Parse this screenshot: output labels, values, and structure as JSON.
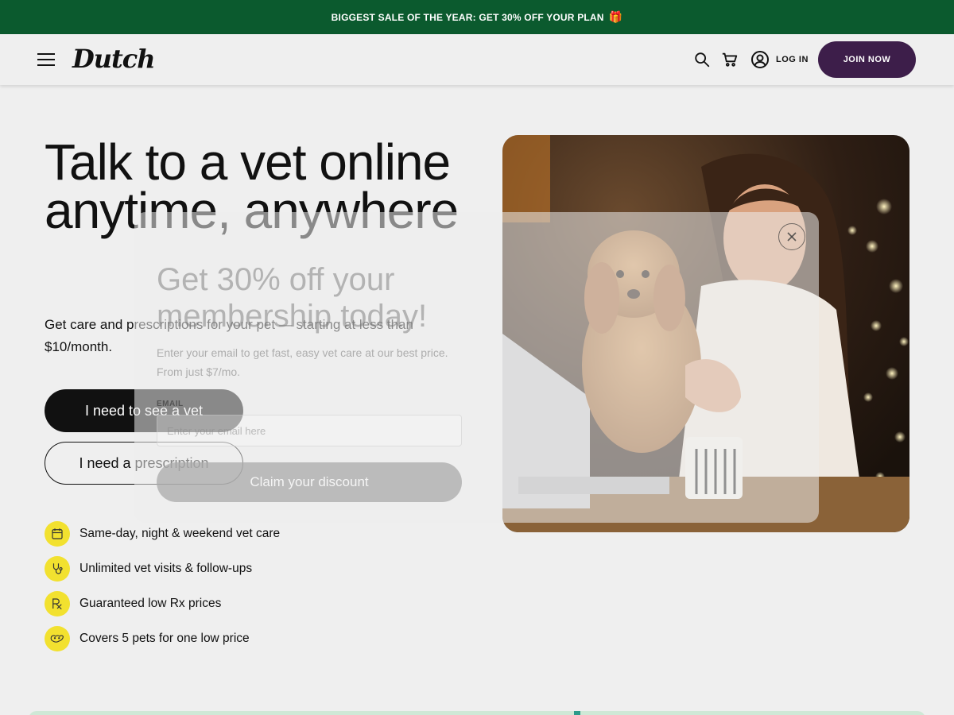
{
  "banner": {
    "text": "BIGGEST SALE OF THE YEAR: GET 30% OFF YOUR PLAN",
    "icon": "gift-icon"
  },
  "nav": {
    "logo": "Dutch",
    "login_label": "LOG IN",
    "join_label": "JOIN NOW",
    "icons": [
      "menu-icon",
      "search-icon",
      "cart-icon",
      "user-icon"
    ]
  },
  "hero": {
    "title": "Talk to a vet online anytime, anywhere",
    "subtitle": "Get care and prescriptions for your pet — starting at less than $10/month.",
    "primary_button": "I need to see a vet",
    "secondary_button": "I need a prescription",
    "features": [
      {
        "label": "Same-day, night & weekend vet care",
        "icon": "calendar-icon"
      },
      {
        "label": "Unlimited vet visits & follow-ups",
        "icon": "stethoscope-icon"
      },
      {
        "label": "Guaranteed low Rx prices",
        "icon": "rx-icon"
      },
      {
        "label": "Covers 5 pets for one low price",
        "icon": "pets-icon"
      }
    ]
  },
  "modal": {
    "title": "Get 30% off your membership today!",
    "description": "Enter your email to get fast, easy vet care at our best price. From just $7/mo.",
    "email_label": "EMAIL",
    "email_placeholder": "Enter your email here",
    "cta_label": "Claim your discount"
  },
  "colors": {
    "banner_bg": "#0b5a2e",
    "join_bg": "#3d1e4a",
    "badge_yellow": "#f2e12f",
    "page_bg": "#efefef"
  }
}
